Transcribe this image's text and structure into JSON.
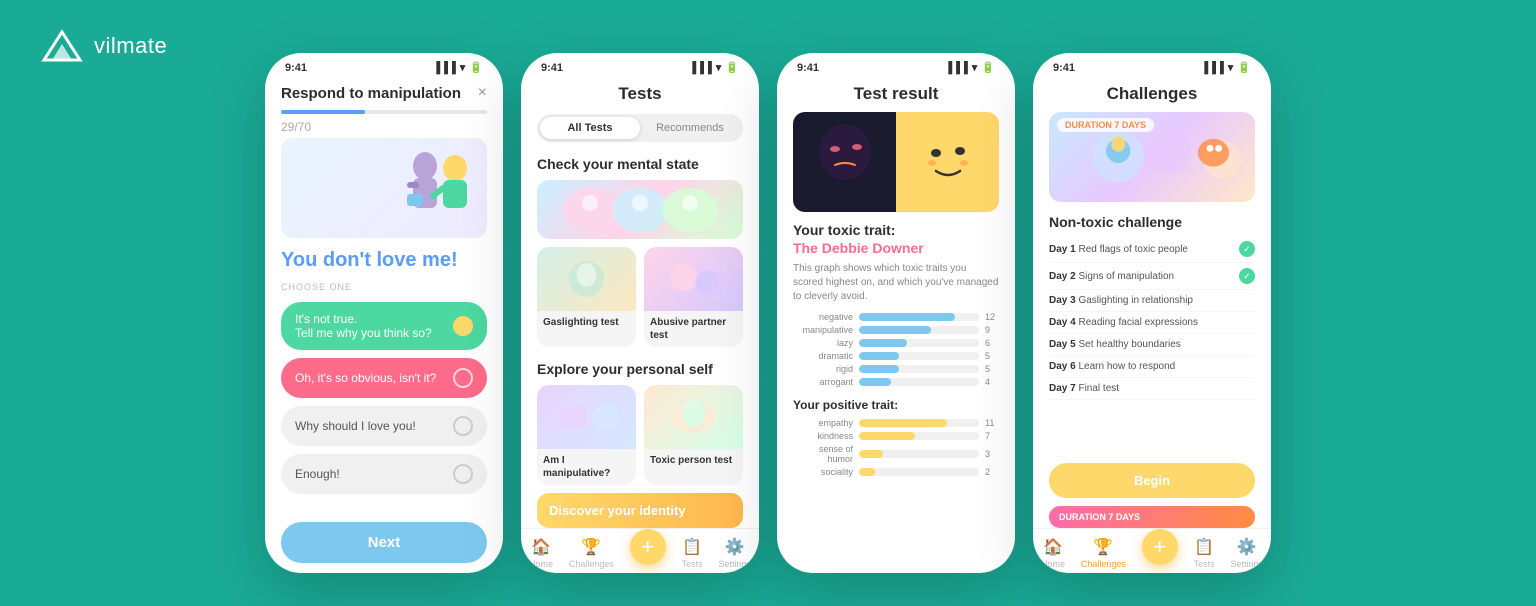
{
  "logo": {
    "text": "vilmate"
  },
  "phone1": {
    "status_time": "9:41",
    "title": "Respond to manipulation",
    "close_label": "×",
    "counter": "29/70",
    "question": "You don't love me!",
    "choose_label": "CHOOSE ONE",
    "options": [
      {
        "text": "It's not true. Tell me why you think so?",
        "style": "green"
      },
      {
        "text": "Oh, it's so obvious, isn't it?",
        "style": "pink"
      },
      {
        "text": "Why should I love you!",
        "style": "light"
      },
      {
        "text": "Enough!",
        "style": "light"
      }
    ],
    "next_label": "Next"
  },
  "phone2": {
    "status_time": "9:41",
    "title": "Tests",
    "tabs": [
      {
        "label": "All Tests",
        "active": true
      },
      {
        "label": "Recommends",
        "active": false
      }
    ],
    "section1_title": "Check your mental state",
    "section2_title": "Explore your personal self",
    "section3_title": "Discover your identity",
    "test_cards_row1": [
      {
        "label": "Gaslighting test"
      },
      {
        "label": "Abusive partner test"
      }
    ],
    "test_cards_row2": [
      {
        "label": "Am I manipulative?"
      },
      {
        "label": "Toxic person test"
      }
    ],
    "nav_items": [
      {
        "label": "Home",
        "icon": "🏠",
        "active": false
      },
      {
        "label": "Challenges",
        "icon": "🏆",
        "active": false
      },
      {
        "label": "+",
        "icon": "+",
        "fab": true
      },
      {
        "label": "Tests",
        "icon": "📋",
        "active": false
      },
      {
        "label": "Settings",
        "icon": "⚙️",
        "active": false
      }
    ]
  },
  "phone3": {
    "status_time": "9:41",
    "title": "Test result",
    "toxic_trait_heading": "Your toxic trait:",
    "toxic_trait_name": "The Debbie Downer",
    "toxic_trait_desc": "This graph shows which toxic traits you scored highest on, and which you've managed to cleverly avoid.",
    "bar_chart_negative": [
      {
        "label": "negative",
        "value": 12,
        "max": 15
      },
      {
        "label": "manipulative",
        "value": 9,
        "max": 15
      },
      {
        "label": "lazy",
        "value": 6,
        "max": 15
      },
      {
        "label": "dramatic",
        "value": 5,
        "max": 15
      },
      {
        "label": "rigid",
        "value": 5,
        "max": 15
      },
      {
        "label": "arrogant",
        "value": 4,
        "max": 15
      }
    ],
    "positive_trait_heading": "Your positive trait:",
    "bar_chart_positive": [
      {
        "label": "empathy",
        "value": 11,
        "max": 15
      },
      {
        "label": "kindness",
        "value": 7,
        "max": 15
      },
      {
        "label": "sense of humor",
        "value": 3,
        "max": 15
      },
      {
        "label": "sociality",
        "value": 2,
        "max": 15
      }
    ]
  },
  "phone4": {
    "status_time": "9:41",
    "title": "Challenges",
    "duration_badge": "DURATION 7 DAYS",
    "challenge_title": "Non-toxic challenge",
    "days": [
      {
        "day": "Day 1",
        "label": "Red flags of toxic people",
        "done": true
      },
      {
        "day": "Day 2",
        "label": "Signs of manipulation",
        "done": true
      },
      {
        "day": "Day 3",
        "label": "Gaslighting in relationship",
        "done": false
      },
      {
        "day": "Day 4",
        "label": "Reading facial expressions",
        "done": false
      },
      {
        "day": "Day 5",
        "label": "Set healthy boundaries",
        "done": false
      },
      {
        "day": "Day 6",
        "label": "Learn how to respond",
        "done": false
      },
      {
        "day": "Day 7",
        "label": "Final test",
        "done": false
      }
    ],
    "begin_label": "Begin",
    "next_duration_badge": "DURATION 7 DAYS",
    "nav_items": [
      {
        "label": "Home",
        "icon": "🏠",
        "active": false
      },
      {
        "label": "Challenges",
        "icon": "🏆",
        "active": true
      },
      {
        "label": "+",
        "icon": "+",
        "fab": true
      },
      {
        "label": "Tests",
        "icon": "📋",
        "active": false
      },
      {
        "label": "Settings",
        "icon": "⚙️",
        "active": false
      }
    ]
  },
  "colors": {
    "teal": "#1aab96",
    "blue": "#7ec8f0",
    "green": "#4cd8a0",
    "pink": "#ff6b8a",
    "yellow": "#ffd86b",
    "purple": "#b8a4d8"
  }
}
